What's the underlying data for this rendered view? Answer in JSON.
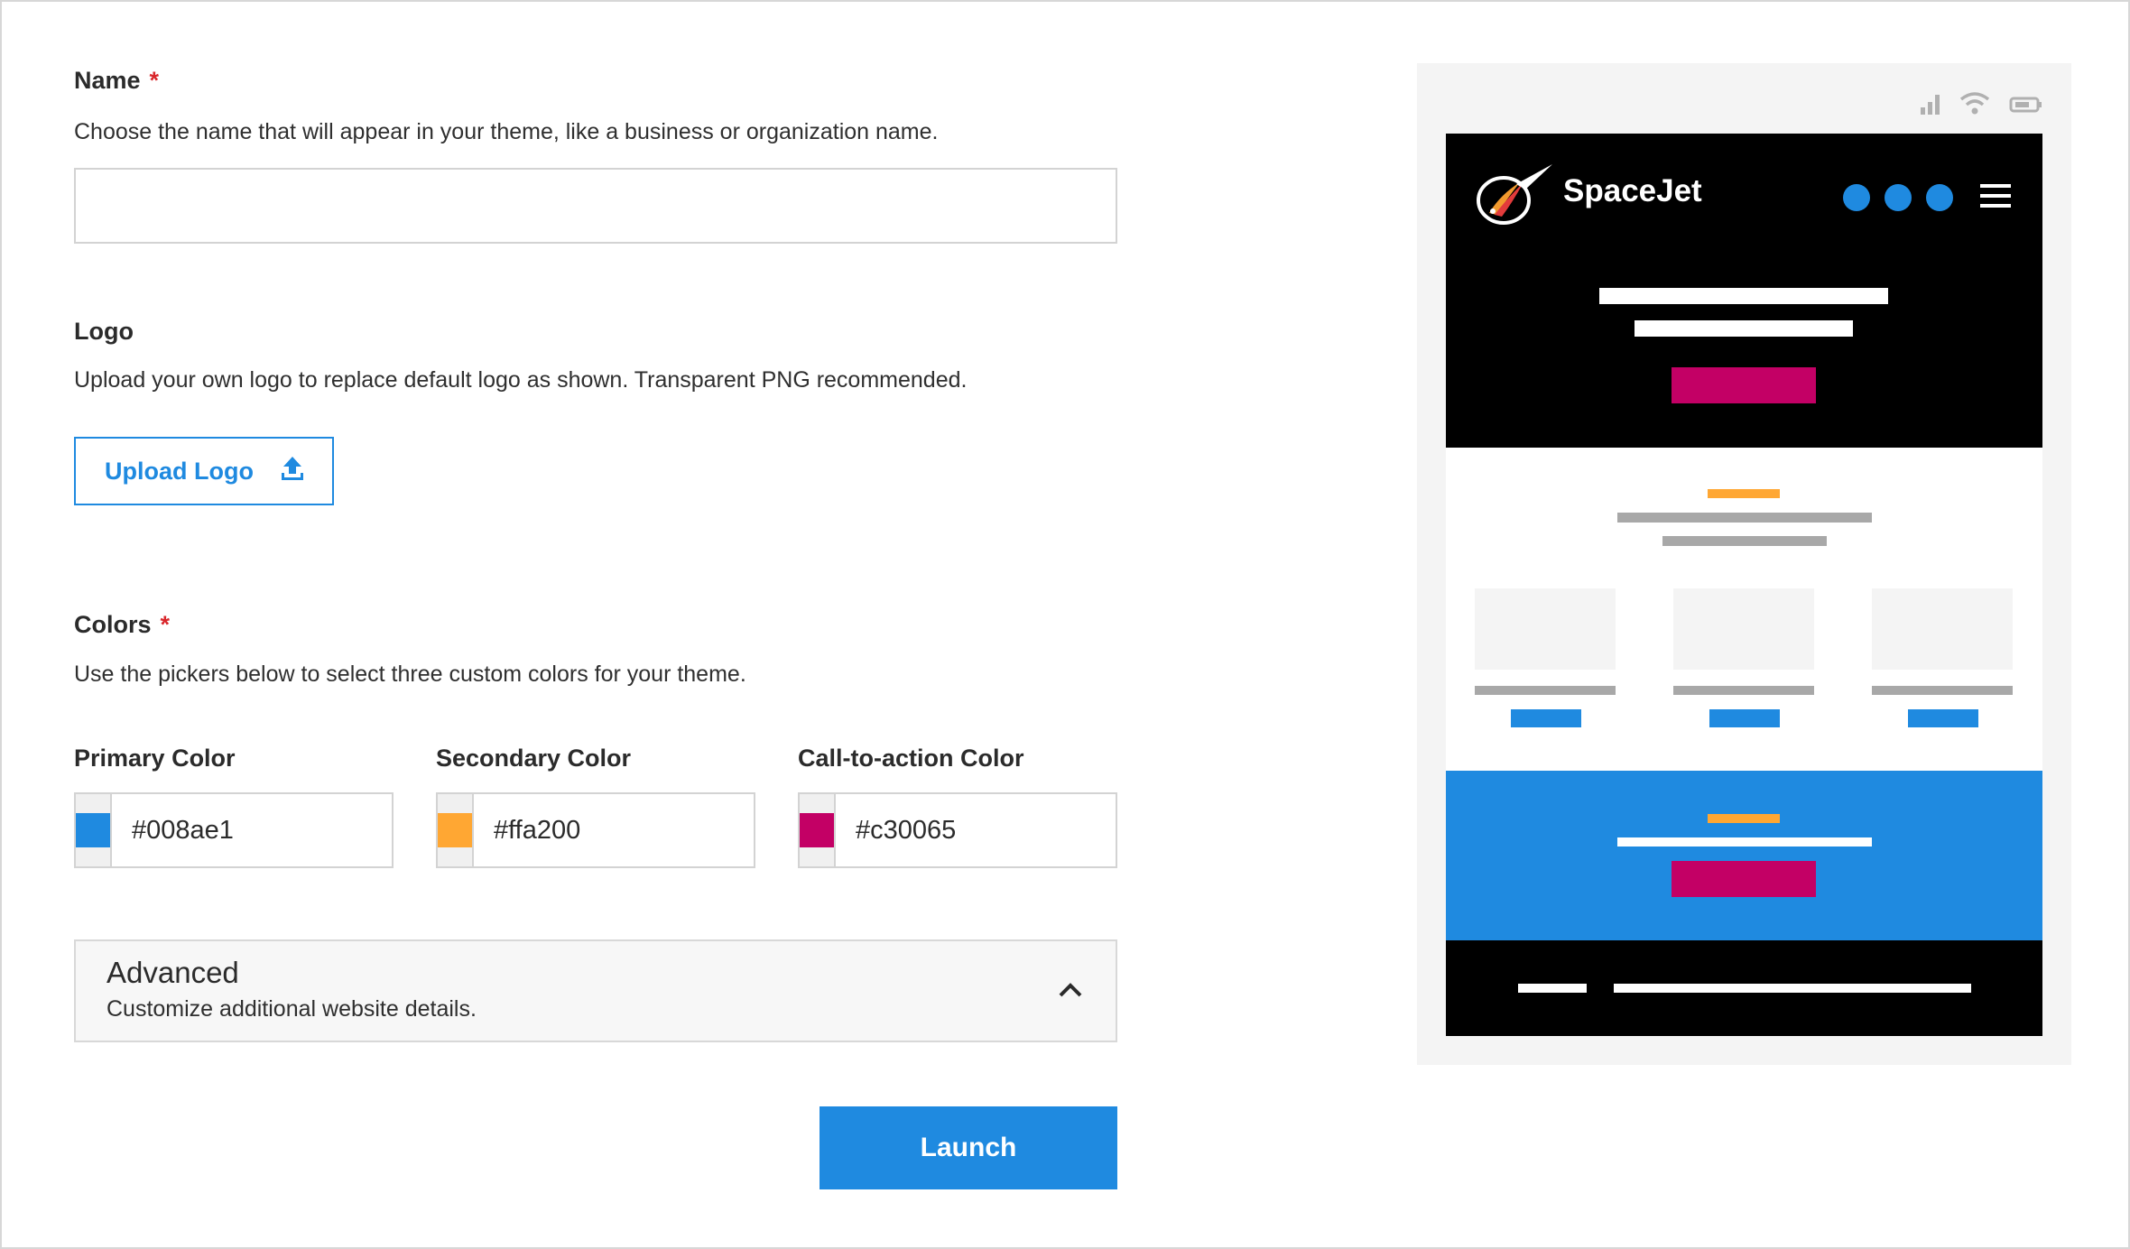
{
  "form": {
    "name": {
      "label": "Name",
      "required_mark": "*",
      "help": "Choose the name that will appear in your theme, like a business or organization name.",
      "value": "",
      "placeholder": ""
    },
    "logo": {
      "label": "Logo",
      "help": "Upload your own logo to replace default logo as shown. Transparent PNG recommended.",
      "upload_label": "Upload Logo",
      "upload_icon": "upload-icon"
    },
    "colors": {
      "label": "Colors",
      "required_mark": "*",
      "help": "Use the pickers below to select three custom colors for your theme.",
      "primary": {
        "label": "Primary Color",
        "value": "#008ae1"
      },
      "secondary": {
        "label": "Secondary Color",
        "value": "#ffa200"
      },
      "cta": {
        "label": "Call-to-action Color",
        "value": "#c30065"
      }
    },
    "advanced": {
      "title": "Advanced",
      "description": "Customize additional website details.",
      "icon": "chevron-up-icon"
    },
    "launch_label": "Launch"
  },
  "preview": {
    "brand_name": "SpaceJet",
    "status_icons": [
      "signal-icon",
      "wifi-icon",
      "battery-icon"
    ],
    "colors": {
      "header_bg": "#000000",
      "primary": "#1f8ae0",
      "secondary": "#ffa200",
      "cta": "#c30065",
      "placeholder_gray": "#a8a8a8",
      "card_bg": "#f4f4f4"
    }
  }
}
